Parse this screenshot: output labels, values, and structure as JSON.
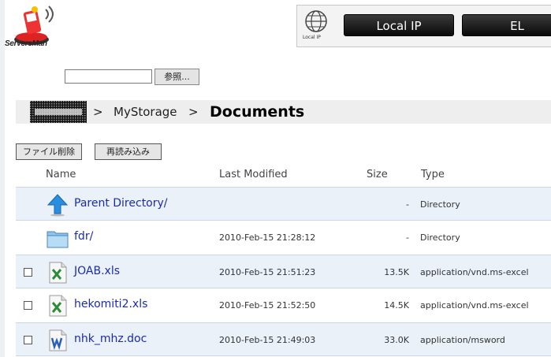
{
  "header": {
    "logo_text": "ServersMan",
    "globe_label": "Local IP",
    "buttons": [
      "Local IP",
      "EL"
    ]
  },
  "upload": {
    "browse_label": "参照..."
  },
  "breadcrumb": {
    "separator": ">",
    "path": [
      "MyStorage"
    ],
    "current": "Documents"
  },
  "actions": {
    "delete_label": "ファイル削除",
    "reload_label": "再読み込み"
  },
  "columns": {
    "name": "Name",
    "modified": "Last Modified",
    "size": "Size",
    "type": "Type"
  },
  "files": [
    {
      "name": "Parent Directory/",
      "modified": "",
      "size": "-",
      "type": "Directory",
      "icon": "arrow-up-icon",
      "checkbox": false
    },
    {
      "name": "fdr/",
      "modified": "2010-Feb-15 21:28:12",
      "size": "-",
      "type": "Directory",
      "icon": "folder-icon",
      "checkbox": false
    },
    {
      "name": "JOAB.xls",
      "modified": "2010-Feb-15 21:51:23",
      "size": "13.5K",
      "type": "application/vnd.ms-excel",
      "icon": "excel-file-icon",
      "checkbox": true
    },
    {
      "name": "hekomiti2.xls",
      "modified": "2010-Feb-15 21:52:50",
      "size": "14.5K",
      "type": "application/vnd.ms-excel",
      "icon": "excel-file-icon",
      "checkbox": true
    },
    {
      "name": "nhk_mhz.doc",
      "modified": "2010-Feb-15 21:49:03",
      "size": "33.0K",
      "type": "application/msword",
      "icon": "word-file-icon",
      "checkbox": true
    }
  ],
  "colors": {
    "row_shade": "#eaf1f9",
    "link": "#1a2cae",
    "header_button": "#111111"
  }
}
